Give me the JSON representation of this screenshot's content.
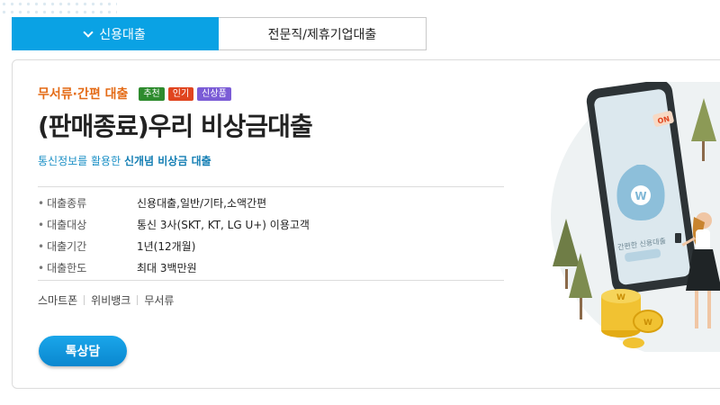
{
  "tabs": [
    {
      "label": "신용대출",
      "active": true
    },
    {
      "label": "전문직/제휴기업대출",
      "active": false
    }
  ],
  "product": {
    "category": "무서류·간편 대출",
    "badges": [
      {
        "label": "추천",
        "color": "#2e8b2e"
      },
      {
        "label": "인기",
        "color": "#e0451f"
      },
      {
        "label": "신상품",
        "color": "#7b5cd6"
      }
    ],
    "title": "(판매종료)우리 비상금대출",
    "subtitle_prefix": "통신정보를 활용한",
    "subtitle_highlight": "신개념 비상금 대출",
    "info": [
      {
        "label": "대출종류",
        "value": "신용대출,일반/기타,소액간편"
      },
      {
        "label": "대출대상",
        "value": "통신 3사(SKT, KT, LG U+) 이용고객"
      },
      {
        "label": "대출기간",
        "value": "1년(12개월)"
      },
      {
        "label": "대출한도",
        "value": "최대 3백만원"
      }
    ],
    "tags": [
      "스마트폰",
      "위비뱅크",
      "무서류"
    ],
    "consult_button": "톡상담"
  },
  "illustration": {
    "phone_text": "간편한 신용대출",
    "sign_text": "ON",
    "coin_symbol": "W"
  },
  "colors": {
    "accent": "#0aa2e4",
    "category": "#e46b16"
  }
}
